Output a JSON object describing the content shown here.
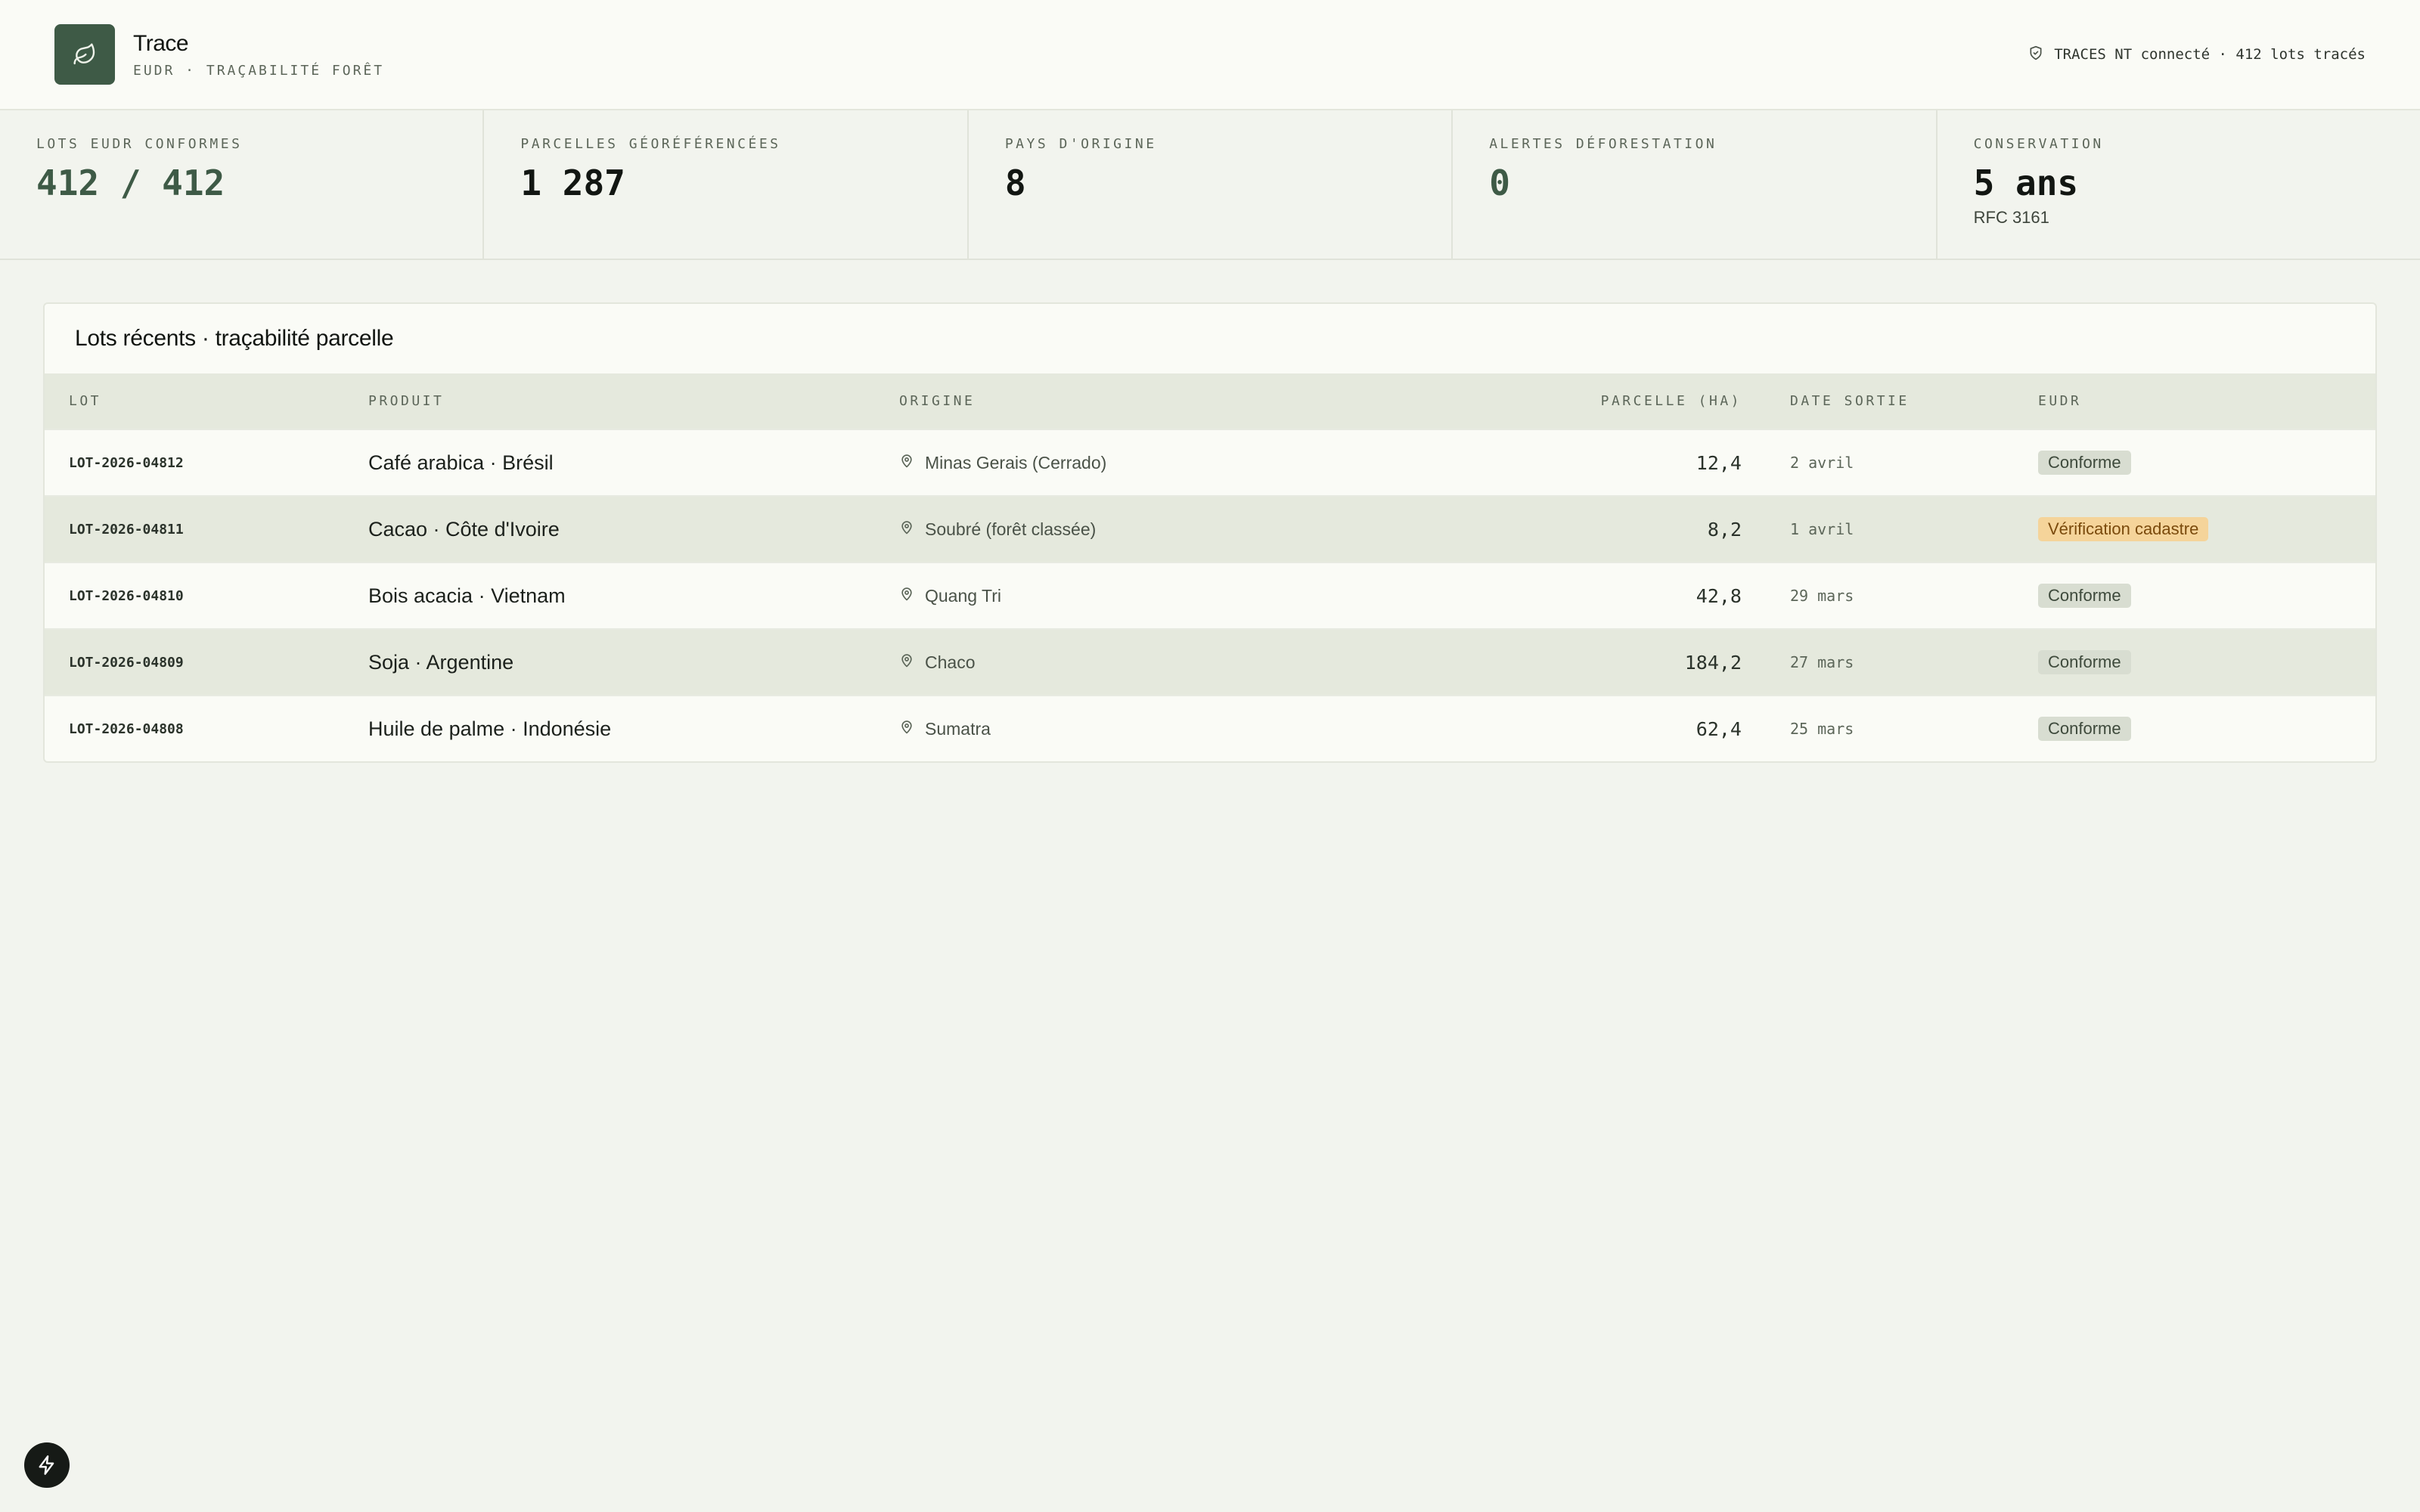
{
  "header": {
    "title": "Trace",
    "subtitle": "EUDR · TRAÇABILITÉ FORÊT",
    "status": "TRACES NT connecté · 412 lots tracés",
    "logo_icon": "leaf-icon",
    "status_icon": "shield-icon"
  },
  "stats": [
    {
      "label": "LOTS EUDR CONFORMES",
      "value": "412 / 412",
      "note": ""
    },
    {
      "label": "PARCELLES GÉORÉFÉRENCÉES",
      "value": "1 287",
      "note": ""
    },
    {
      "label": "PAYS D'ORIGINE",
      "value": "8",
      "note": ""
    },
    {
      "label": "ALERTES DÉFORESTATION",
      "value": "0",
      "note": ""
    },
    {
      "label": "CONSERVATION",
      "value": "5 ans",
      "note": "RFC 3161"
    }
  ],
  "table": {
    "title": "Lots récents · traçabilité parcelle",
    "headers": {
      "lot": "LOT",
      "produit": "PRODUIT",
      "origine": "ORIGINE",
      "parcelle": "PARCELLE (HA)",
      "date": "DATE SORTIE",
      "eudr": "EUDR"
    },
    "rows": [
      {
        "lot": "LOT-2026-04812",
        "produit": "Café arabica · Brésil",
        "origine": "Minas Gerais (Cerrado)",
        "parcelle": "12,4",
        "date": "2 avril",
        "eudr": "Conforme",
        "status": "ok"
      },
      {
        "lot": "LOT-2026-04811",
        "produit": "Cacao · Côte d'Ivoire",
        "origine": "Soubré (forêt classée)",
        "parcelle": "8,2",
        "date": "1 avril",
        "eudr": "Vérification cadastre",
        "status": "warn"
      },
      {
        "lot": "LOT-2026-04810",
        "produit": "Bois acacia · Vietnam",
        "origine": "Quang Tri",
        "parcelle": "42,8",
        "date": "29 mars",
        "eudr": "Conforme",
        "status": "ok"
      },
      {
        "lot": "LOT-2026-04809",
        "produit": "Soja · Argentine",
        "origine": "Chaco",
        "parcelle": "184,2",
        "date": "27 mars",
        "eudr": "Conforme",
        "status": "ok"
      },
      {
        "lot": "LOT-2026-04808",
        "produit": "Huile de palme · Indonésie",
        "origine": "Sumatra",
        "parcelle": "62,4",
        "date": "25 mars",
        "eudr": "Conforme",
        "status": "ok"
      }
    ]
  },
  "colors": {
    "brand": "#3e5a46",
    "background": "#f2f4ee",
    "warn_badge": "#f5d49a",
    "ok_badge": "#d8ddd1"
  },
  "fab_icon": "lightning-icon"
}
